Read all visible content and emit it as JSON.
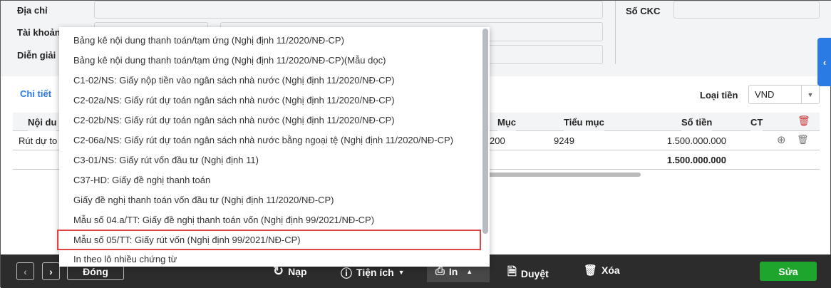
{
  "form": {
    "address_label": "Địa chỉ",
    "account_label": "Tài khoản",
    "description_label": "Diễn giải",
    "ckc_label": "Số CKC"
  },
  "detail": {
    "tab_label": "Chi tiết",
    "currency_label": "Loại tiền",
    "currency_value": "VND"
  },
  "table": {
    "headers": {
      "content": "Nội du",
      "muc": "Mục",
      "tieu_muc": "Tiểu mục",
      "so_tien": "Số tiền",
      "ct": "CT"
    },
    "rows": [
      {
        "content": "Rút dự to",
        "muc": "200",
        "tieu_muc": "9249",
        "so_tien": "1.500.000.000"
      }
    ],
    "total": "1.500.000.000"
  },
  "menu": {
    "items": [
      "Bảng kê nội dung thanh toán/tạm ứng (Nghị định 11/2020/NĐ-CP)",
      "Bảng kê nội dung thanh toán/tạm ứng (Nghị định 11/2020/NĐ-CP)(Mẫu dọc)",
      "C1-02/NS: Giấy nộp tiền vào ngân sách nhà nước (Nghị định 11/2020/NĐ-CP)",
      "C2-02a/NS: Giấy rút dự toán ngân sách nhà nước (Nghị định 11/2020/NĐ-CP)",
      "C2-02b/NS: Giấy rút dự toán ngân sách nhà nước (Nghị định 11/2020/NĐ-CP)",
      "C2-06a/NS: Giấy rút dự toán ngân sách nhà nước bằng ngoại tệ (Nghị định 11/2020/NĐ-CP)",
      "C3-01/NS: Giấy rút vốn đầu tư (Nghị định 11)",
      "C37-HD: Giấy đề nghị thanh toán",
      "Giấy đề nghị thanh toán vốn đầu tư (Nghị định 11/2020/NĐ-CP)",
      "Mẫu số 04.a/TT: Giấy đề nghị thanh toán vốn (Nghị định 99/2021/NĐ-CP)",
      "Mẫu số 05/TT: Giấy rút vốn (Nghị định 99/2021/NĐ-CP)",
      "In theo lô nhiều chứng từ"
    ]
  },
  "toolbar": {
    "close": "Đóng",
    "reload": "Nạp",
    "utilities": "Tiện ích",
    "print": "In",
    "approve": "Duyệt",
    "delete": "Xóa",
    "edit": "Sửa"
  },
  "colors": {
    "accent": "#2a7be4",
    "edit": "#1ea52e",
    "highlight": "#e04444"
  }
}
